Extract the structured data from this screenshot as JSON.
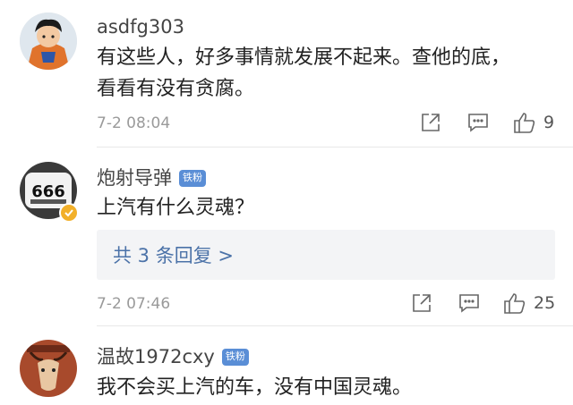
{
  "comments": [
    {
      "username": "asdfg303",
      "badge": "",
      "lines": [
        "有这些人，好多事情就发展不起来。查他的底，",
        "看看有没有贪腐。"
      ],
      "time": "7-2 08:04",
      "likes": "9",
      "verified": false
    },
    {
      "username": "炮射导弹",
      "badge": "铁粉",
      "lines": [
        "上汽有什么灵魂？"
      ],
      "reply_text": "共 3 条回复 >",
      "time": "7-2 07:46",
      "likes": "25",
      "verified": true,
      "avatar_text": "666"
    },
    {
      "username": "温故1972cxy",
      "badge": "铁粉",
      "lines": [
        "我不会买上汽的车，没有中国灵魂。"
      ],
      "verified": false
    }
  ],
  "colors": {
    "badge": "#5a8ed6",
    "reply_link": "#4b72a8",
    "verified": "#f2b02a"
  },
  "icons": [
    "share-icon",
    "comment-icon",
    "thumbs-up-icon"
  ]
}
